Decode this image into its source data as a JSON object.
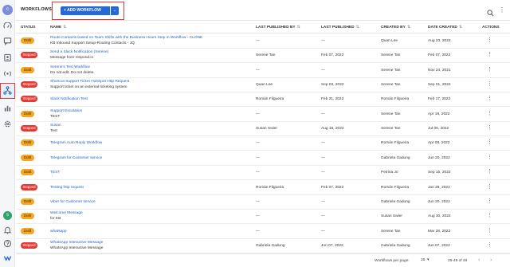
{
  "sidebar": {
    "avatar_initial": "c",
    "bottom_avatar_initial": "s"
  },
  "header": {
    "title": "WORKFLOWS",
    "add_button_label": "+ ADD WORKFLOW",
    "dropdown_glyph": "⌄",
    "more_glyph": "⋮"
  },
  "table": {
    "columns": {
      "status": "STATUS",
      "name": "NAME",
      "last_published_by": "LAST PUBLISHED BY",
      "last_published": "LAST PUBLISHED",
      "created_by": "CREATED BY",
      "date_created": "DATE CREATED",
      "actions": "ACTIONS"
    },
    "sort_glyph": "⇅",
    "actions_glyph": "⋮",
    "rows": [
      {
        "status": "Draft",
        "name": "Route Contacts based on Team Shifts with the Business Hours Step in Workflow - CLONE",
        "desc": "KB Inbound Support Setup-Routing Contacts - JQ",
        "lpb": "—",
        "lp": "—",
        "cb": "Quan Lee",
        "dc": "Aug 23, 2022"
      },
      {
        "status": "Stopped",
        "name": "Send a Slack Notification (Serene)",
        "desc": "Message from respond.io",
        "lpb": "Serene Tan",
        "lp": "Feb 07, 2022",
        "cb": "Serene Tan",
        "dc": "Feb 07, 2022"
      },
      {
        "status": "Draft",
        "name": "Serene's Test Workflow",
        "desc": "Do not edit. Do not delete.",
        "lpb": "—",
        "lp": "—",
        "cb": "Serene Tan",
        "dc": "Nov 24, 2021"
      },
      {
        "status": "Stopped",
        "name": "Shortcut Support Ticket HubSpot Http Request",
        "desc": "Support ticket on an external ticketing system",
        "lpb": "Quan Lee",
        "lp": "Sep 03, 2022",
        "cb": "Serene Tan",
        "dc": "Sep 01, 2022"
      },
      {
        "status": "Stopped",
        "name": "Slack Notification Test",
        "desc": "",
        "lpb": "Román Filgueira",
        "lp": "Feb 21, 2022",
        "cb": "Román Filgueira",
        "dc": "Feb 17, 2022"
      },
      {
        "status": "Draft",
        "name": "Support Escalation",
        "desc": "TEST",
        "lpb": "—",
        "lp": "—",
        "cb": "Serene Tan",
        "dc": "Apr 19, 2022"
      },
      {
        "status": "Stopped",
        "name": "Susan",
        "desc": "Test",
        "lpb": "Susan Swier",
        "lp": "Aug 18, 2022",
        "cb": "Serene Tan",
        "dc": "Jul 06, 2022"
      },
      {
        "status": "Draft",
        "name": "Telegram Auto Reply Workflow",
        "desc": "",
        "lpb": "—",
        "lp": "—",
        "cb": "Román Filgueira",
        "dc": "Apr 08, 2022"
      },
      {
        "status": "Draft",
        "name": "Telegram for Customer service",
        "desc": "",
        "lpb": "—",
        "lp": "—",
        "cb": "Gabriela Gadung",
        "dc": "Jun 20, 2022"
      },
      {
        "status": "Draft",
        "name": "TEST",
        "desc": "",
        "lpb": "—",
        "lp": "—",
        "cb": "Petrina Jo",
        "dc": "Sep 15, 2022"
      },
      {
        "status": "Stopped",
        "name": "Testing http request",
        "desc": "",
        "lpb": "Román Filgueira",
        "lp": "Feb 07, 2022",
        "cb": "Román Filgueira",
        "dc": "Jan 28, 2022"
      },
      {
        "status": "Draft",
        "name": "Viber for Customer service",
        "desc": "",
        "lpb": "—",
        "lp": "—",
        "cb": "Gabriela Gadung",
        "dc": "Jun 20, 2022"
      },
      {
        "status": "Draft",
        "name": "Welcome Message",
        "desc": "for KB",
        "lpb": "—",
        "lp": "—",
        "cb": "Susan Swier",
        "dc": "Aug 30, 2022"
      },
      {
        "status": "Draft",
        "name": "whatsapp",
        "desc": "",
        "lpb": "—",
        "lp": "—",
        "cb": "Serene Tan",
        "dc": "Mar 28, 2022"
      },
      {
        "status": "Stopped",
        "name": "WhatsApp Interactive Message",
        "desc": "WhatsApp Interactive Message",
        "lpb": "Gabriela Gadung",
        "lp": "Jun 07, 2022",
        "cb": "Gabriela Gadung",
        "dc": "Jun 07, 2022"
      }
    ]
  },
  "footer": {
    "per_page_label": "Workflows per page:",
    "per_page_value": "25",
    "select_glyph": "▾",
    "range": "26-49 of 49",
    "prev_glyph": "‹",
    "next_glyph": "›"
  },
  "colors": {
    "primary": "#2568d8",
    "draft": "#f5a623",
    "stopped": "#e53935",
    "link": "#1e63c6"
  }
}
